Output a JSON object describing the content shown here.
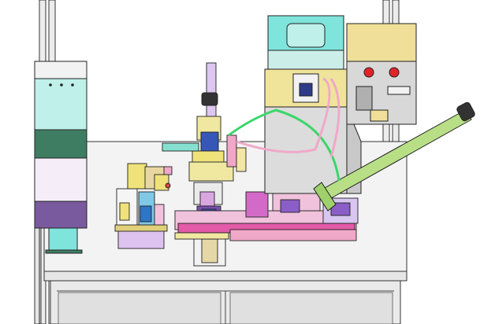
{
  "scene": {
    "colors": {
      "background": "#ffffff",
      "frame": "#e8e8e8",
      "table_top": "#f4f4f4",
      "outline": "#222222",
      "cyan": "#7fe4dc",
      "dark_green": "#3f7d62",
      "lavender": "#f3eef7",
      "purple": "#7a5a9e",
      "yellow": "#efe27a",
      "magenta": "#e25aa8",
      "pink": "#f0a8c8",
      "gray_plate": "#c8c8c8",
      "tan": "#e6d7a6",
      "light_green_tube": "#b8df86",
      "green_hose": "#3bd66a",
      "red_button": "#e0242a"
    },
    "components": [
      "vertical-cabinet-left",
      "workbench-table",
      "fixture-assembly-left",
      "press-station-center",
      "conveyor-rail",
      "column-housing",
      "control-box",
      "lever-arm",
      "pneumatic-hoses"
    ]
  }
}
